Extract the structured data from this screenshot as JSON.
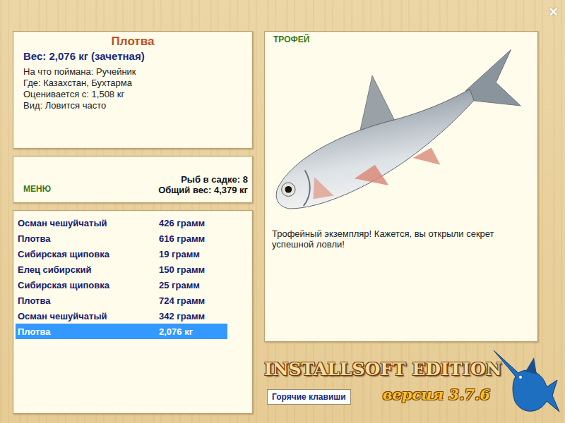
{
  "window": {
    "close": "×"
  },
  "fish": {
    "name": "Плотва",
    "weight": "Вес: 2,076 кг (зачетная)",
    "details": [
      "На что поймана: Ручейник",
      "Где: Казахстан, Бухтарма",
      "Оценивается с: 1,508 кг",
      "Вид: Ловится часто"
    ]
  },
  "menu": {
    "label": "МЕНЮ",
    "count": "Рыб в садке: 8",
    "total": "Общий вес: 4,379 кг"
  },
  "catch_list": [
    {
      "name": "Осман чешуйчатый",
      "weight": "426 грамм",
      "selected": false
    },
    {
      "name": "Плотва",
      "weight": "616 грамм",
      "selected": false
    },
    {
      "name": "Сибирская щиповка",
      "weight": "19 грамм",
      "selected": false
    },
    {
      "name": "Елец сибирский",
      "weight": "150 грамм",
      "selected": false
    },
    {
      "name": "Сибирская щиповка",
      "weight": "25 грамм",
      "selected": false
    },
    {
      "name": "Плотва",
      "weight": "724 грамм",
      "selected": false
    },
    {
      "name": "Осман чешуйчатый",
      "weight": "342 грамм",
      "selected": false
    },
    {
      "name": "Плотва",
      "weight": "2,076 кг",
      "selected": true
    }
  ],
  "trophy": {
    "badge": "ТРОФЕЙ",
    "message": "Трофейный экземпляр! Кажется, вы открыли секрет успешной ловли!"
  },
  "logo": {
    "title": "INSTALLSOFT EDITION",
    "version": "версия 3.7.6"
  },
  "hotkeys_button": "Горячие клавиши"
}
